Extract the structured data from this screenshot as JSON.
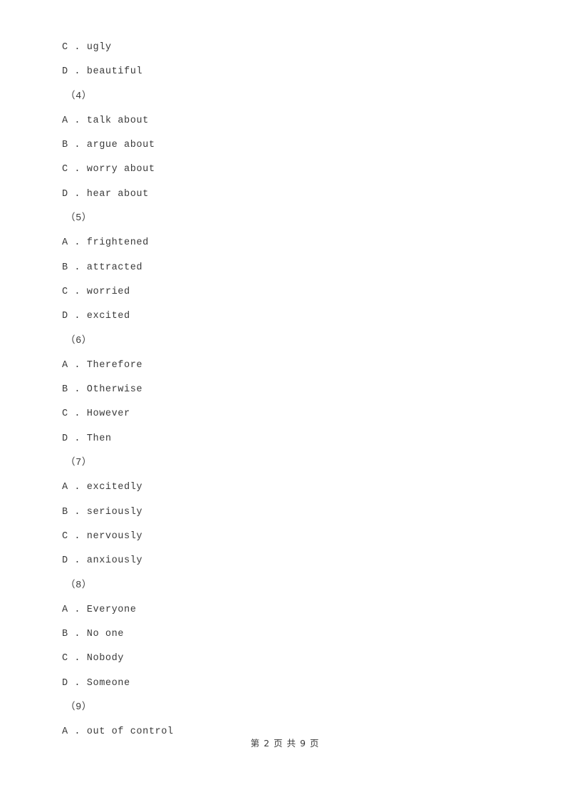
{
  "document": {
    "page_background": "#ffffff",
    "text_color": "#3a3a3a"
  },
  "lines": [
    {
      "kind": "option",
      "text": "C . ugly"
    },
    {
      "kind": "option",
      "text": "D . beautiful"
    },
    {
      "kind": "qnum",
      "text": "（4）"
    },
    {
      "kind": "option",
      "text": "A . talk about"
    },
    {
      "kind": "option",
      "text": "B . argue about"
    },
    {
      "kind": "option",
      "text": "C . worry about"
    },
    {
      "kind": "option",
      "text": "D . hear about"
    },
    {
      "kind": "qnum",
      "text": "（5）"
    },
    {
      "kind": "option",
      "text": "A . frightened"
    },
    {
      "kind": "option",
      "text": "B . attracted"
    },
    {
      "kind": "option",
      "text": "C . worried"
    },
    {
      "kind": "option",
      "text": "D . excited"
    },
    {
      "kind": "qnum",
      "text": "（6）"
    },
    {
      "kind": "option",
      "text": "A . Therefore"
    },
    {
      "kind": "option",
      "text": "B . Otherwise"
    },
    {
      "kind": "option",
      "text": "C . However"
    },
    {
      "kind": "option",
      "text": "D . Then"
    },
    {
      "kind": "qnum",
      "text": "（7）"
    },
    {
      "kind": "option",
      "text": "A . excitedly"
    },
    {
      "kind": "option",
      "text": "B . seriously"
    },
    {
      "kind": "option",
      "text": "C . nervously"
    },
    {
      "kind": "option",
      "text": "D . anxiously"
    },
    {
      "kind": "qnum",
      "text": "（8）"
    },
    {
      "kind": "option",
      "text": "A . Everyone"
    },
    {
      "kind": "option",
      "text": "B . No one"
    },
    {
      "kind": "option",
      "text": "C . Nobody"
    },
    {
      "kind": "option",
      "text": "D . Someone"
    },
    {
      "kind": "qnum",
      "text": "（9）"
    },
    {
      "kind": "option",
      "text": "A . out of control"
    }
  ],
  "footer": {
    "text": "第 2 页 共 9 页",
    "current_page": "2",
    "total_pages": "9"
  }
}
